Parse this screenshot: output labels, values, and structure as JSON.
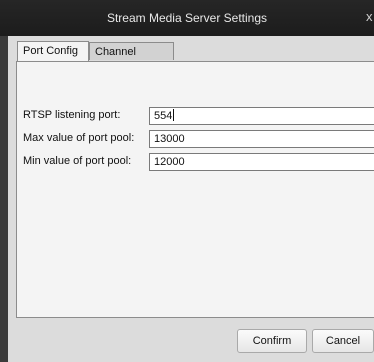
{
  "window": {
    "title": "Stream Media Server Settings",
    "close_glyph": "x"
  },
  "tabs": [
    {
      "label": "Port Config",
      "active": true
    },
    {
      "label": "Channel Config",
      "active": false
    }
  ],
  "fields": [
    {
      "label": "RTSP listening port:",
      "value": "554"
    },
    {
      "label": "Max value of port pool:",
      "value": "13000"
    },
    {
      "label": "Min value of port pool:",
      "value": "12000"
    }
  ],
  "buttons": {
    "confirm": "Confirm",
    "cancel": "Cancel"
  }
}
